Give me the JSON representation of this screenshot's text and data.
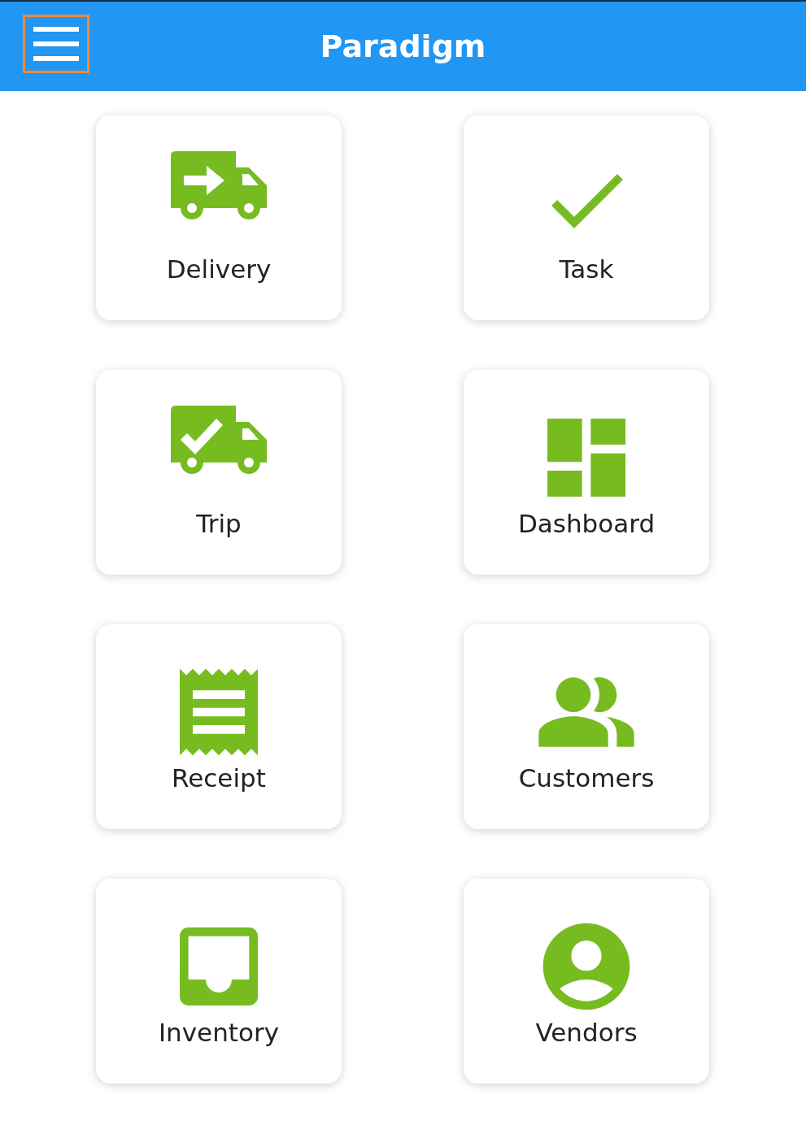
{
  "header": {
    "title": "Paradigm",
    "menu_button": {
      "focused": true
    }
  },
  "tiles": [
    {
      "kind": "delivery",
      "label": "Delivery"
    },
    {
      "kind": "task",
      "label": "Task"
    },
    {
      "kind": "trip",
      "label": "Trip"
    },
    {
      "kind": "dashboard",
      "label": "Dashboard"
    },
    {
      "kind": "receipt",
      "label": "Receipt"
    },
    {
      "kind": "customers",
      "label": "Customers"
    },
    {
      "kind": "inventory",
      "label": "Inventory"
    },
    {
      "kind": "vendors",
      "label": "Vendors"
    }
  ]
}
